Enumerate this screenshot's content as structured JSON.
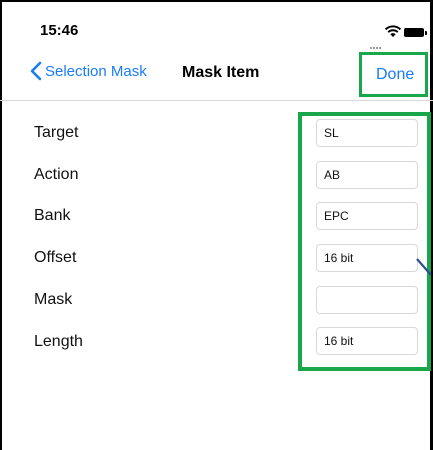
{
  "status_bar": {
    "time": "15:46",
    "icons": [
      "signal-icon",
      "wifi-icon",
      "battery-icon"
    ]
  },
  "nav": {
    "back_label": "Selection Mask",
    "title": "Mask Item",
    "done_label": "Done"
  },
  "form": {
    "target": {
      "label": "Target",
      "value": "SL"
    },
    "action": {
      "label": "Action",
      "value": "AB"
    },
    "bank": {
      "label": "Bank",
      "value": "EPC"
    },
    "offset": {
      "label": "Offset",
      "value": "16 bit"
    },
    "mask": {
      "label": "Mask",
      "value": ""
    },
    "length": {
      "label": "Length",
      "value": "16 bit"
    }
  },
  "colors": {
    "accent": "#1a7cf5",
    "highlight": "#1aa64a"
  }
}
